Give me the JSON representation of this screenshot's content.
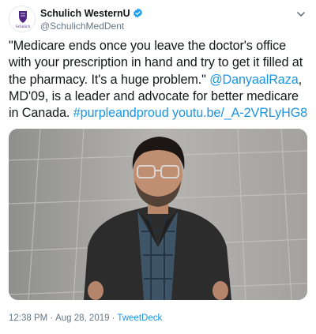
{
  "account": {
    "display_name": "Schulich WesternU",
    "handle": "@SchulichMedDent",
    "avatar_text": "Schulich",
    "verified": true
  },
  "tweet": {
    "text_plain": "\"Medicare ends once you leave the doctor's office with your prescription in hand and try to get it filled at the pharmacy. It's a huge problem.\" ",
    "mention": "@DanyaalRaza",
    "text_after_mention": ", MD'09, is a leader and advocate for better medicare in Canada. ",
    "hashtag": "#purpleandproud",
    "link": "youtu.be/_A-2VRLyHG8"
  },
  "meta": {
    "time": "12:38 PM",
    "separator": "·",
    "date": "Aug 28, 2019",
    "source": "TweetDeck"
  },
  "colors": {
    "link": "#1b95e0",
    "text": "#14171a",
    "muted": "#657786",
    "verified": "#1da1f2",
    "brand_purple": "#4f2683"
  },
  "icons": {
    "verified": "verified-badge-icon",
    "caret": "chevron-down-icon"
  }
}
